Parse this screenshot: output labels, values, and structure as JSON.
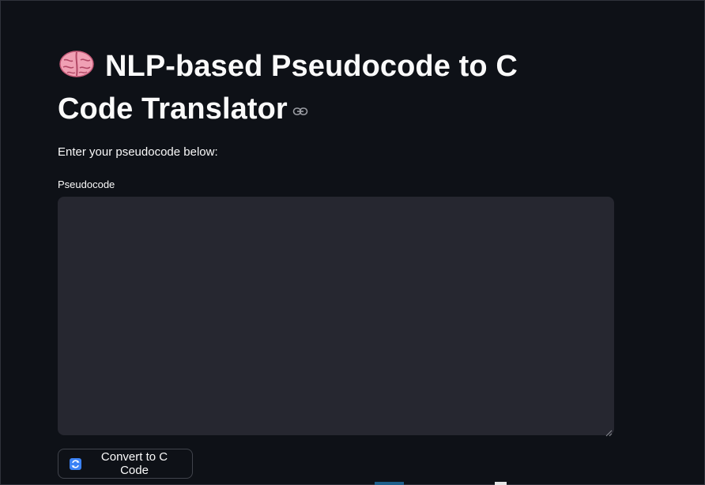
{
  "header": {
    "title": "NLP-based Pseudocode to C Code Translator",
    "title_icon": "brain-emoji-icon",
    "anchor_icon": "link-icon"
  },
  "main": {
    "intro": "Enter your pseudocode below:",
    "pseudocode": {
      "label": "Pseudocode",
      "value": "",
      "placeholder": ""
    },
    "convert_button": {
      "label": "Convert to C Code",
      "icon": "repeat-arrows-icon"
    }
  },
  "colors": {
    "background": "#0e1117",
    "input_background": "#262730",
    "text": "#fafafa",
    "accent_icon": "#3b82f6"
  }
}
